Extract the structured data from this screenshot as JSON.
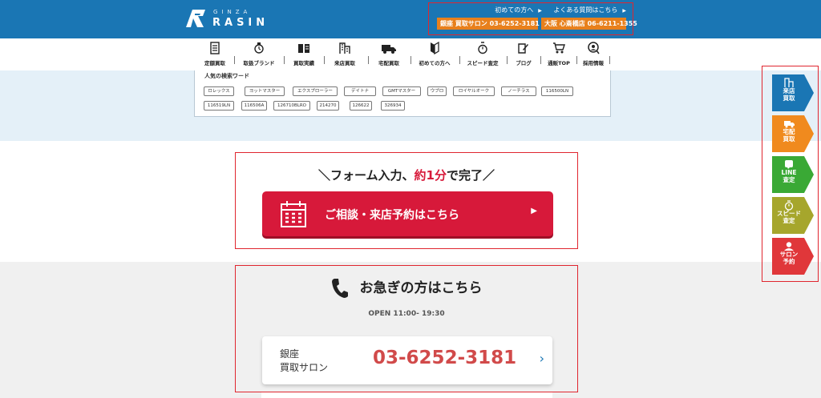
{
  "header": {
    "logo_sub": "GINZA",
    "logo_main": "RASIN",
    "link_first": "初めての方へ",
    "link_faq": "よくある質問はこちら",
    "tel_ginza": "銀座 買取サロン 03-6252-3181",
    "tel_osaka": "大阪 心斎橋店 06-6211-1355"
  },
  "nav": [
    {
      "label": "定額買取",
      "icon": "list-icon"
    },
    {
      "label": "取扱ブランド",
      "icon": "watch-icon"
    },
    {
      "label": "買取実績",
      "icon": "book-icon"
    },
    {
      "label": "来店買取",
      "icon": "building-icon"
    },
    {
      "label": "宅配買取",
      "icon": "truck-icon"
    },
    {
      "label": "初めての方へ",
      "icon": "beginner-mark-icon"
    },
    {
      "label": "スピード査定",
      "icon": "stopwatch-icon"
    },
    {
      "label": "ブログ",
      "icon": "edit-icon"
    },
    {
      "label": "通販TOP",
      "icon": "cart-icon"
    },
    {
      "label": "採用情報",
      "icon": "person-search-icon"
    }
  ],
  "search": {
    "title": "人気の検索ワード",
    "tags": [
      "ロレックス",
      "ヨットマスター",
      "エクスプローラー",
      "デイトナ",
      "GMTマスター",
      "ウブロ",
      "ロイヤルオーク",
      "ノーチラス",
      "116500LN",
      "116519LN",
      "116506A",
      "126710BLRO",
      "214270",
      "126622",
      "326934"
    ]
  },
  "cta": {
    "head_prefix": "＼フォーム入力、",
    "head_highlight": "約1分",
    "head_suffix": "で完了／",
    "button_label": "ご相談・来店予約はこちら",
    "arrow": "▶"
  },
  "urgent": {
    "title": "お急ぎの方はこちら",
    "hours": "OPEN 11:00- 19:30",
    "salon_line1": "銀座",
    "salon_line2": "買取サロン",
    "salon_tel": "03-6252-3181",
    "chevron": "›"
  },
  "side_menu": [
    {
      "line1": "来店",
      "line2": "買取",
      "color": "#1a76b4",
      "icon": "building-icon"
    },
    {
      "line1": "宅配",
      "line2": "買取",
      "color": "#f08a1e",
      "icon": "truck-icon"
    },
    {
      "line1": "LINE",
      "line2": "査定",
      "color": "#3aa935",
      "icon": "line-icon"
    },
    {
      "line1": "スピード",
      "line2": "査定",
      "color": "#a6a62c",
      "icon": "stopwatch-icon"
    },
    {
      "line1": "サロン",
      "line2": "予約",
      "color": "#e0373a",
      "icon": "salon-icon"
    }
  ]
}
